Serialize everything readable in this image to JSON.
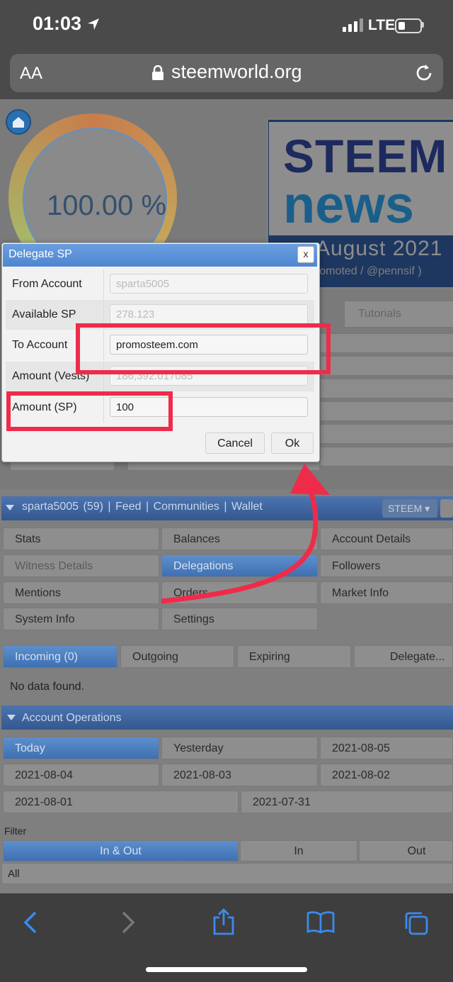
{
  "status": {
    "time": "01:03",
    "network": "LTE"
  },
  "browser": {
    "text_size": "AA",
    "url": "steemworld.org"
  },
  "gauge": {
    "value": "100.00 %"
  },
  "banner": {
    "line1": "STEEM",
    "line2": "news",
    "date": "August 2021",
    "sub": "romoted / @pennsif )"
  },
  "tabs": {
    "tutorials": "Tutorials"
  },
  "dialog": {
    "title": "Delegate SP",
    "close": "x",
    "fields": [
      {
        "label": "From Account",
        "value": "sparta5005"
      },
      {
        "label": "Available SP",
        "value": "278.123"
      },
      {
        "label": "To Account",
        "value": "promosteem.com"
      },
      {
        "label": "Amount (Vests)",
        "value": "186,392.017085"
      },
      {
        "label": "Amount (SP)",
        "value": "100"
      }
    ],
    "cancel": "Cancel",
    "ok": "Ok"
  },
  "nav": {
    "account": "sparta5005 (59)",
    "sep": "|",
    "feed": "Feed",
    "communities": "Communities",
    "wallet": "Wallet",
    "currency": "STEEM"
  },
  "menu": {
    "stats": "Stats",
    "balances": "Balances",
    "account_details": "Account Details",
    "witness_details": "Witness Details",
    "delegations": "Delegations",
    "followers": "Followers",
    "mentions": "Mentions",
    "orders": "Orders",
    "market_info": "Market Info",
    "system_info": "System Info",
    "settings": "Settings"
  },
  "delegation_tabs": {
    "incoming": "Incoming (0)",
    "outgoing": "Outgoing",
    "expiring": "Expiring",
    "delegate": "Delegate..."
  },
  "no_data": "No data found.",
  "operations": {
    "header": "Account Operations",
    "days": [
      "Today",
      "Yesterday",
      "2021-08-05",
      "2021-08-04",
      "2021-08-03",
      "2021-08-02",
      "2021-08-01",
      "2021-07-31"
    ],
    "filter_label": "Filter",
    "filters": [
      "In & Out",
      "In",
      "Out"
    ],
    "all": "All"
  },
  "colors": {
    "accent": "#4f86d0",
    "highlight": "#ef2b4a"
  }
}
